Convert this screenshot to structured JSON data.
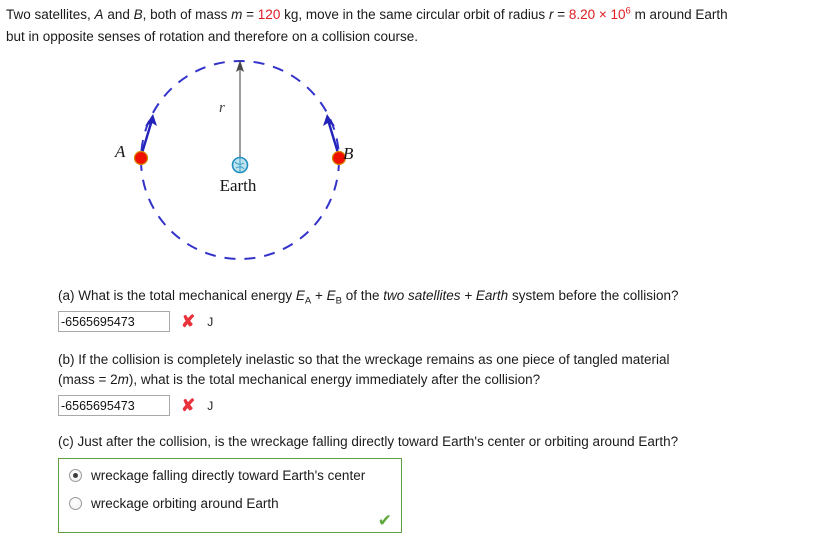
{
  "problem": {
    "intro_1": "Two satellites, ",
    "intro_a": "A",
    "intro_2": " and ",
    "intro_b": "B",
    "intro_3": ", both of mass ",
    "intro_m": "m",
    "intro_eq": " = ",
    "mass_value": "120",
    "mass_unit": " kg, move in the same circular orbit of radius ",
    "intro_r": "r",
    "intro_eq2": " = ",
    "radius_value": "8.20",
    "radius_times": " × 10",
    "radius_exp": "6",
    "radius_tail": " m around Earth",
    "intro_line2": "but in opposite senses of rotation and therefore on a collision course."
  },
  "figure": {
    "label_a": "A",
    "label_b": "B",
    "label_r": "r",
    "label_earth": "Earth",
    "orbit_color": "#3333cc",
    "satellite_color": "#f01000",
    "velocity_arrow_color": "#2222bb",
    "radius_line_color": "#8c8c8c",
    "earth_color": "#1f8fbf"
  },
  "part_a": {
    "text_1": "(a) What is the total mechanical energy ",
    "e_sym": "E",
    "sub_a": "A",
    "plus": " + ",
    "e_sym2": "E",
    "sub_b": "B",
    "text_2": " of the ",
    "italic_phrase": "two satellites + Earth",
    "text_3": " system before the collision?",
    "answer_value": "-6565695473",
    "mark": "✘",
    "unit": "J"
  },
  "part_b": {
    "text_line1": "(b) If the collision is completely inelastic so that the wreckage remains as one piece of tangled material",
    "text_line2_1": "(mass = 2",
    "text_line2_m": "m",
    "text_line2_2": "), what is the total mechanical energy immediately after the collision?",
    "answer_value": "-6565695473",
    "mark": "✘",
    "unit": "J"
  },
  "part_c": {
    "text": "(c) Just after the collision, is the wreckage falling directly toward Earth's center or orbiting around Earth?",
    "option_1": "wreckage falling directly toward Earth's center",
    "option_2": "wreckage orbiting around Earth",
    "selected_index": 0,
    "mark": "✔",
    "border_color": "#5f9e41",
    "check_color": "#5fa83f"
  }
}
